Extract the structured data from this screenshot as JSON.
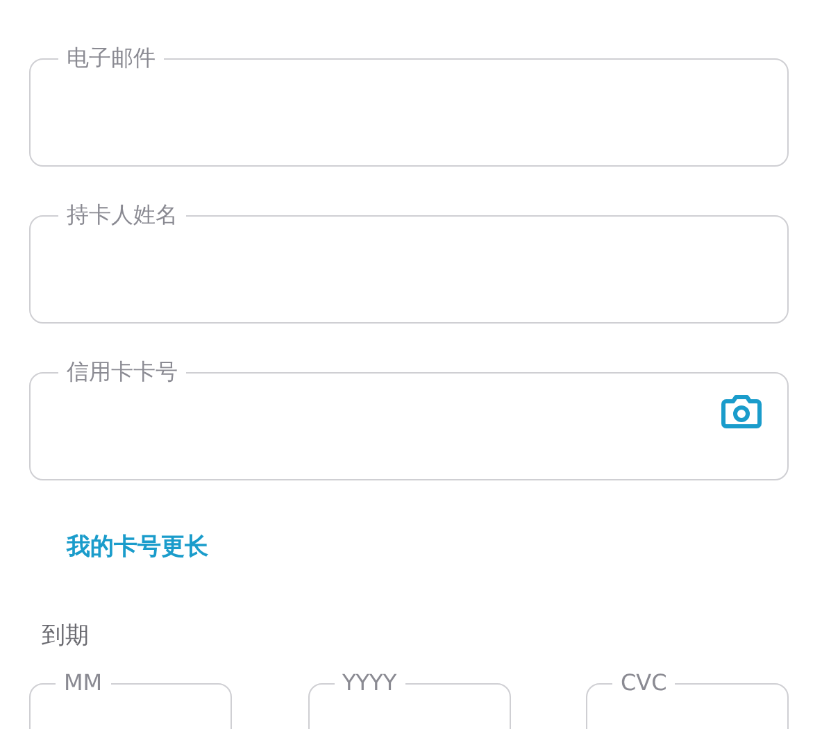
{
  "fields": [
    {
      "label": "电子邮件",
      "kind": "plain"
    },
    {
      "label": "持卡人姓名",
      "kind": "plain"
    },
    {
      "label": "信用卡卡号",
      "kind": "scan"
    }
  ],
  "link": "我的卡号更长",
  "expiry_label": "到期",
  "short_fields": [
    {
      "label": "MM"
    },
    {
      "label": "YYYY"
    },
    {
      "label": "CVC"
    }
  ]
}
